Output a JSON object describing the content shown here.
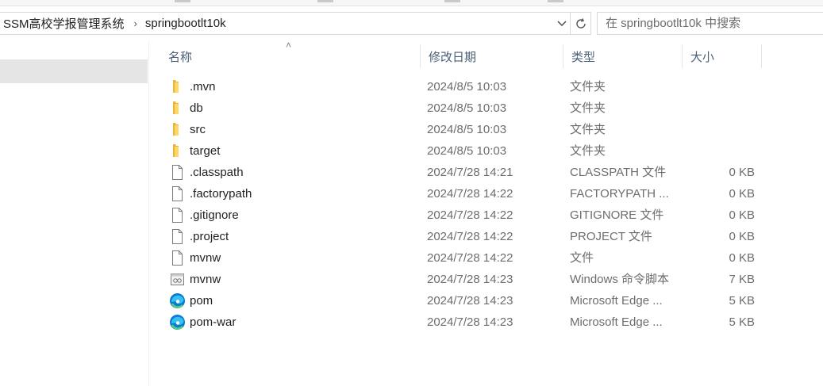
{
  "address": {
    "breadcrumbs": [
      "SSM高校学报管理系统",
      "springbootlt10k"
    ],
    "separator_icon": "chevron-right-icon",
    "dropdown_icon": "chevron-down-icon",
    "refresh_icon": "refresh-icon"
  },
  "search": {
    "placeholder": "在 springbootlt10k 中搜索"
  },
  "columns": {
    "name": "名称",
    "date": "修改日期",
    "type": "类型",
    "size": "大小"
  },
  "files": [
    {
      "name": ".mvn",
      "date": "2024/8/5 10:03",
      "type": "文件夹",
      "size": "",
      "icon": "folder-icon"
    },
    {
      "name": "db",
      "date": "2024/8/5 10:03",
      "type": "文件夹",
      "size": "",
      "icon": "folder-icon"
    },
    {
      "name": "src",
      "date": "2024/8/5 10:03",
      "type": "文件夹",
      "size": "",
      "icon": "folder-icon"
    },
    {
      "name": "target",
      "date": "2024/8/5 10:03",
      "type": "文件夹",
      "size": "",
      "icon": "folder-icon"
    },
    {
      "name": ".classpath",
      "date": "2024/7/28 14:21",
      "type": "CLASSPATH 文件",
      "size": "0 KB",
      "icon": "file-icon"
    },
    {
      "name": ".factorypath",
      "date": "2024/7/28 14:22",
      "type": "FACTORYPATH ...",
      "size": "0 KB",
      "icon": "file-icon"
    },
    {
      "name": ".gitignore",
      "date": "2024/7/28 14:22",
      "type": "GITIGNORE 文件",
      "size": "0 KB",
      "icon": "file-icon"
    },
    {
      "name": ".project",
      "date": "2024/7/28 14:22",
      "type": "PROJECT 文件",
      "size": "0 KB",
      "icon": "file-icon"
    },
    {
      "name": "mvnw",
      "date": "2024/7/28 14:22",
      "type": "文件",
      "size": "0 KB",
      "icon": "file-icon"
    },
    {
      "name": "mvnw",
      "date": "2024/7/28 14:23",
      "type": "Windows 命令脚本",
      "size": "7 KB",
      "icon": "script-icon"
    },
    {
      "name": "pom",
      "date": "2024/7/28 14:23",
      "type": "Microsoft Edge ...",
      "size": "5 KB",
      "icon": "edge-icon"
    },
    {
      "name": "pom-war",
      "date": "2024/7/28 14:23",
      "type": "Microsoft Edge ...",
      "size": "5 KB",
      "icon": "edge-icon"
    }
  ]
}
